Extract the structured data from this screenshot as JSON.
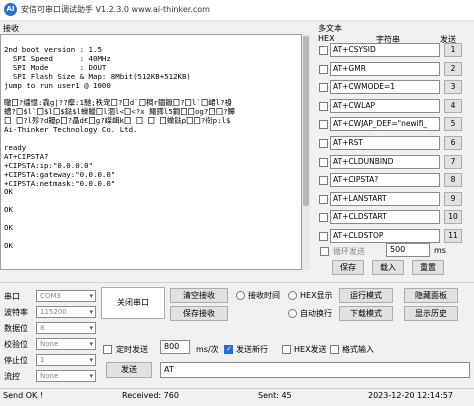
{
  "window": {
    "title": "安信可串口调试助手 V1.2.3.0    www.ai-thinker.com",
    "icon_text": "AI"
  },
  "receive": {
    "label": "接收",
    "text": "\n2nd boot version : 1.5\n  SPI Speed      : 40MHz\n  SPI Mode       : DOUT\n  SPI Flash Size & Map: 8Mbit(512KB+512KB)\njump to run user1 @ 1000\n\n瞮囗?缰憶:毳g|??癴:1馳;秩宠囗?囗d`囗稠r錮鑹囗?囗l`囗峮l?裑\n螬?囗$l`囗$l囗$鍅$l蠔鱲囗l涸l<囗<?x 鱰霠l5鐗囗囗og?囗囗?鱏\n囗 囗?l殄?d耰p囗?瞐d€囗g?嵥衈k囗 囗 囗 囗蟓鍅p囗囗?衑p:l$\nAi-Thinker Technology Co. Ltd.\n\nready\nAT+CIPSTA?\n+CIPSTA:ip:\"0.0.0.0\"\n+CIPSTA:gateway:\"0.0.0.0\"\n+CIPSTA:netmask:\"0.0.0.0\"\nOK\n\nOK\n\nOK\n\nOK"
  },
  "multi": {
    "label": "多文本",
    "headers": {
      "hex": "HEX",
      "string": "字符串",
      "send": "发送"
    },
    "rows": [
      {
        "text": "AT+CSYSID",
        "num": "1"
      },
      {
        "text": "AT+GMR",
        "num": "2"
      },
      {
        "text": "AT+CWMODE=1",
        "num": "3"
      },
      {
        "text": "AT+CWLAP",
        "num": "4"
      },
      {
        "text": "AT+CWJAP_DEF=\"newifi_",
        "num": "5"
      },
      {
        "text": "AT+RST",
        "num": "6"
      },
      {
        "text": "AT+CLDUNBIND",
        "num": "7"
      },
      {
        "text": "AT+CIPSTA?",
        "num": "8"
      },
      {
        "text": "AT+LANSTART",
        "num": "9"
      },
      {
        "text": "AT+CLDSTART",
        "num": "10"
      },
      {
        "text": "AT+CLDSTOP",
        "num": "11"
      }
    ],
    "loop_label": "循环发送",
    "loop_value": "500",
    "ms": "ms",
    "save": "保存",
    "load": "载入",
    "reset": "重置"
  },
  "settings": {
    "port_label": "串口",
    "port_value": "COM3",
    "baud_label": "波特率",
    "baud_value": "115200",
    "databits_label": "数据位",
    "databits_value": "8",
    "parity_label": "校验位",
    "parity_value": "None",
    "stopbits_label": "停止位",
    "stopbits_value": "1",
    "flow_label": "流控",
    "flow_value": "None"
  },
  "buttons": {
    "close_port": "关闭串口",
    "clear_recv": "清空接收",
    "save_recv": "保存接收",
    "run_mode": "运行模式",
    "download_mode": "下载模式",
    "hide_panel": "隐藏面板",
    "show_history": "显示历史",
    "send": "发送"
  },
  "options": {
    "recv_time": "接收时间",
    "hex_show": "HEX显示",
    "auto_newline": "自动换行",
    "timed_send": "定时发送",
    "interval": "800",
    "interval_unit": "ms/次",
    "send_newline": "发送新行",
    "hex_send": "HEX发送",
    "format_input": "格式输入"
  },
  "send_text": "AT",
  "status": {
    "message": "Send OK !",
    "received": "Received: 760",
    "sent": "Sent: 45",
    "datetime": "2023-12-20 12:14:57"
  }
}
